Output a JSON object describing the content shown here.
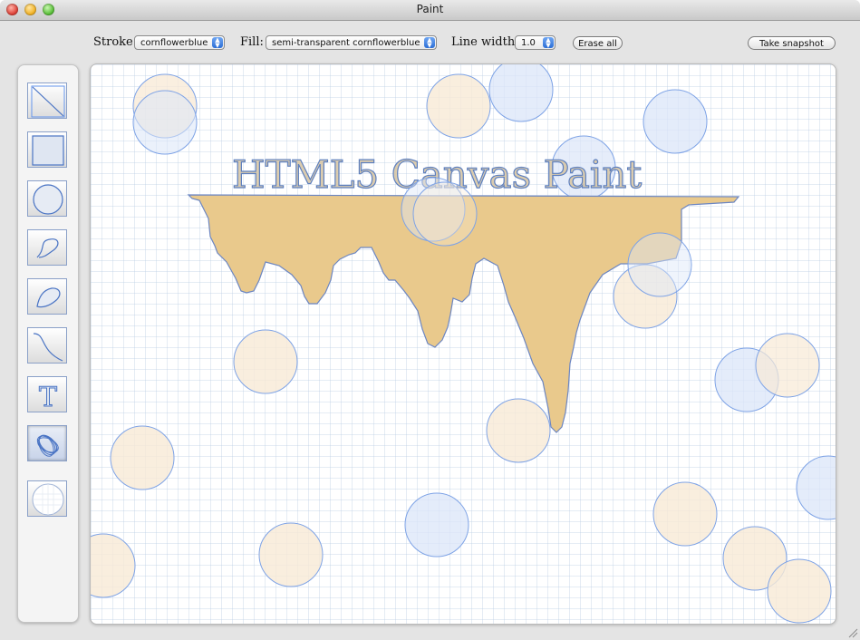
{
  "window": {
    "title": "Paint"
  },
  "toolbar": {
    "stroke_label": "Stroke:",
    "stroke_value": "cornflowerblue",
    "fill_label": "Fill:",
    "fill_value": "semi-transparent cornflowerblue",
    "linewidth_label": "Line width:",
    "linewidth_value": "1.0",
    "erase_label": "Erase all",
    "snapshot_label": "Take snapshot"
  },
  "tools": [
    {
      "name": "line",
      "icon": "line-tool-icon",
      "active": false
    },
    {
      "name": "rectangle",
      "icon": "rectangle-tool-icon",
      "active": false
    },
    {
      "name": "circle",
      "icon": "circle-tool-icon",
      "active": false
    },
    {
      "name": "path",
      "icon": "path-tool-icon",
      "active": false
    },
    {
      "name": "closed path",
      "icon": "closed-path-tool-icon",
      "active": false
    },
    {
      "name": "curve",
      "icon": "curve-tool-icon",
      "active": false
    },
    {
      "name": "text",
      "icon": "text-tool-icon",
      "active": false
    },
    {
      "name": "spirograph",
      "icon": "spirograph-tool-icon",
      "active": true
    },
    {
      "name": "eraser",
      "icon": "eraser-tool-icon",
      "active": false
    }
  ],
  "canvas": {
    "text": "HTML5 Canvas Paint",
    "colors": {
      "stroke": "#6495ed",
      "bubble_blue": "#dbe6f8",
      "bubble_peach": "#f8ead6",
      "drip_fill": "#e9c98c",
      "text_fill": "#cdb894"
    }
  }
}
